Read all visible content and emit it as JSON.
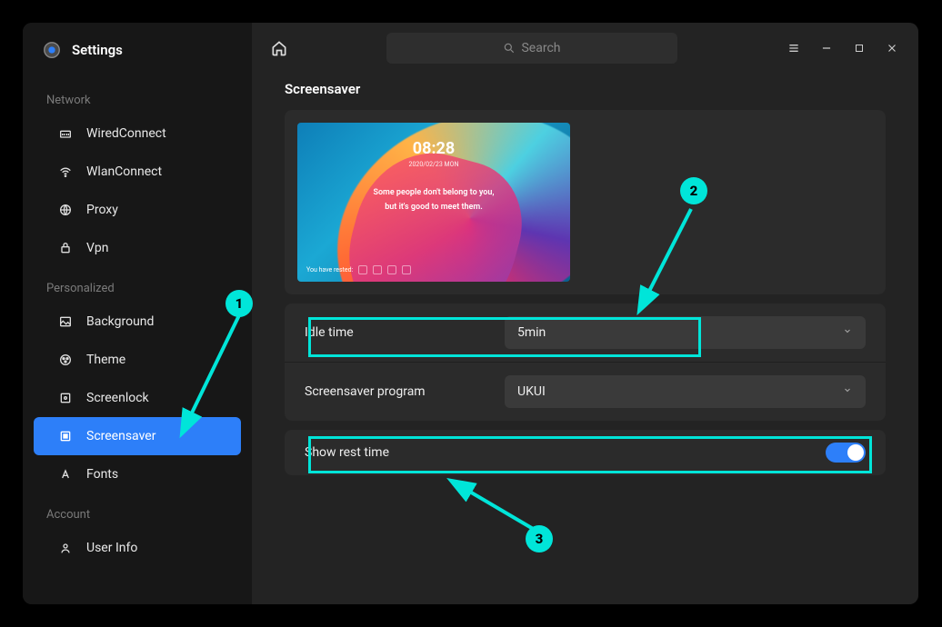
{
  "app": {
    "title": "Settings"
  },
  "search": {
    "placeholder": "Search"
  },
  "sidebar": {
    "groups": [
      {
        "label": "Network",
        "items": [
          {
            "label": "WiredConnect"
          },
          {
            "label": "WlanConnect"
          },
          {
            "label": "Proxy"
          },
          {
            "label": "Vpn"
          }
        ]
      },
      {
        "label": "Personalized",
        "items": [
          {
            "label": "Background"
          },
          {
            "label": "Theme"
          },
          {
            "label": "Screenlock"
          },
          {
            "label": "Screensaver"
          },
          {
            "label": "Fonts"
          }
        ]
      },
      {
        "label": "Account",
        "items": [
          {
            "label": "User Info"
          }
        ]
      }
    ]
  },
  "main": {
    "section_title": "Screensaver",
    "preview": {
      "time": "08:28",
      "date": "2020/02/23 MON",
      "quote1": "Some people don't belong to you,",
      "quote2": "but it's good to meet them.",
      "footer_text": "You have rested:"
    },
    "settings": {
      "idle_label": "Idle time",
      "idle_value": "5min",
      "program_label": "Screensaver program",
      "program_value": "UKUI",
      "rest_label": "Show rest time",
      "rest_on": true
    }
  },
  "annotations": {
    "n1": "1",
    "n2": "2",
    "n3": "3"
  }
}
